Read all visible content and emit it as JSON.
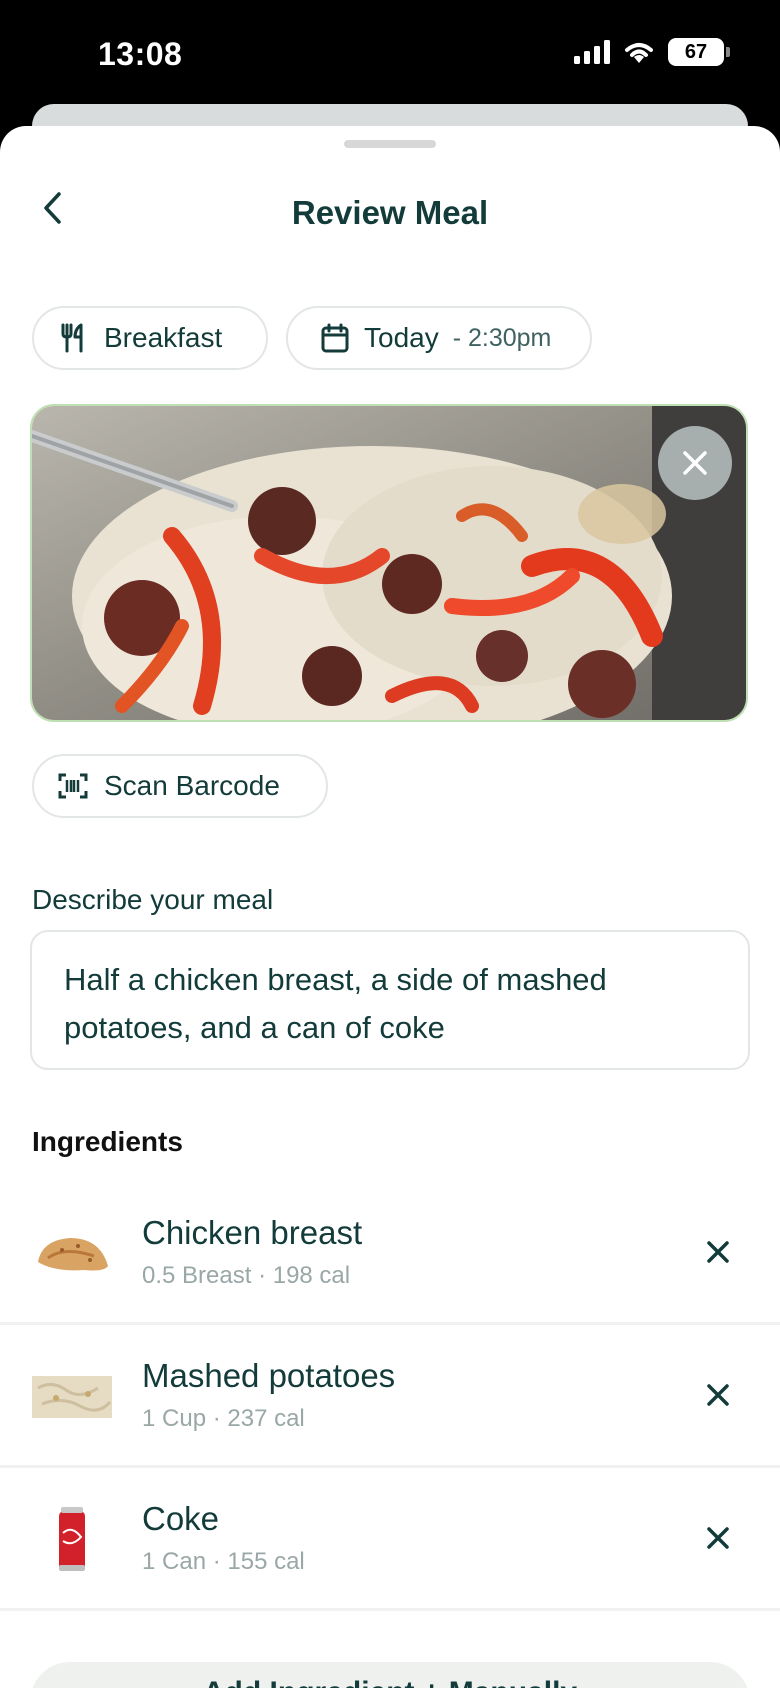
{
  "status_bar": {
    "time": "13:08",
    "battery": "67"
  },
  "header": {
    "title": "Review Meal"
  },
  "chips": {
    "meal_type": "Breakfast",
    "date": "Today",
    "time": "- 2:30pm",
    "scan": "Scan Barcode"
  },
  "describe": {
    "label": "Describe your meal",
    "value": "Half a chicken breast, a side of mashed potatoes, and a can of coke"
  },
  "ingredients": {
    "title": "Ingredients",
    "items": [
      {
        "name": "Chicken breast",
        "meta": "0.5 Breast · 198 cal"
      },
      {
        "name": "Mashed potatoes",
        "meta": "1 Cup · 237 cal"
      },
      {
        "name": "Coke",
        "meta": "1 Can · 155 cal"
      }
    ]
  },
  "actions": {
    "add_label": "Add Ingredient + Manually"
  },
  "colors": {
    "primary": "#123b3a",
    "muted": "#9aa7a7",
    "border": "#e3e6e6"
  }
}
